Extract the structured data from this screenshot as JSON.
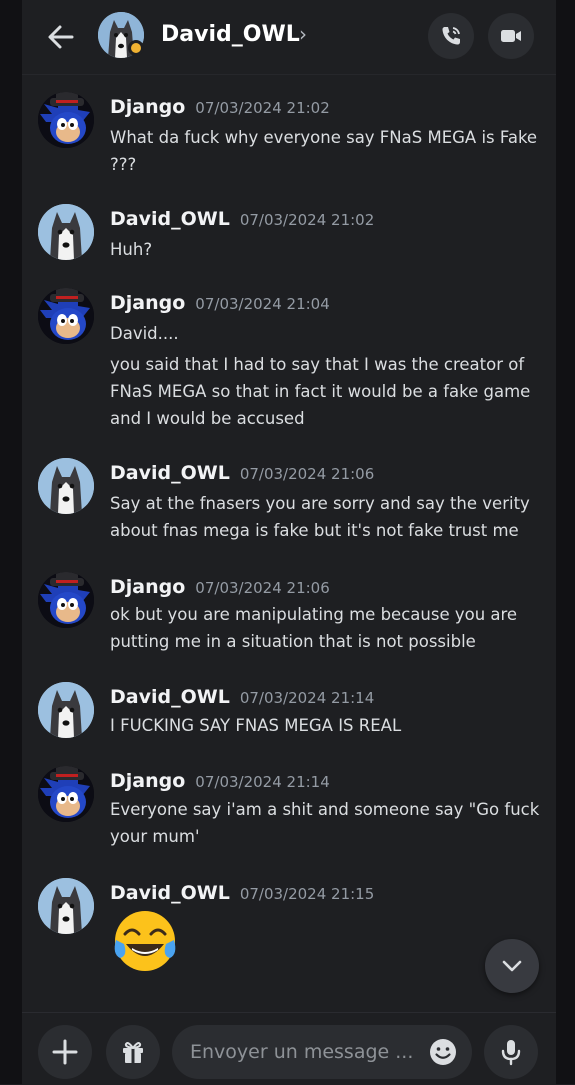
{
  "header": {
    "name": "David_OWL",
    "chevron": "›",
    "icons": [
      "back-arrow-icon",
      "call-icon",
      "video-icon"
    ]
  },
  "messages": [
    {
      "author": "Django",
      "time": "07/03/2024 21:02",
      "text": "What da fuck why everyone say FNaS MEGA is Fake ???",
      "avatar": "sonic-avatar"
    },
    {
      "author": "David_OWL",
      "time": "07/03/2024 21:02",
      "text": "Huh?",
      "avatar": "husky-avatar"
    },
    {
      "author": "Django",
      "time": "07/03/2024 21:04",
      "text": "David....",
      "text2": "you said that I had to say that I was the creator of FNaS MEGA so that in fact it would be a fake game and I would be accused",
      "avatar": "sonic-avatar"
    },
    {
      "author": "David_OWL",
      "time": "07/03/2024 21:06",
      "text": "Say at the fnasers you are sorry and say the verity about fnas mega is fake but it's not fake trust me",
      "avatar": "husky-avatar"
    },
    {
      "author": "Django",
      "time": "07/03/2024 21:06",
      "text": "ok but you are manipulating me because you are putting me in a situation that is not possible",
      "avatar": "sonic-avatar"
    },
    {
      "author": "David_OWL",
      "time": "07/03/2024 21:14",
      "text": "I FUCKING SAY FNAS MEGA IS REAL",
      "avatar": "husky-avatar"
    },
    {
      "author": "Django",
      "time": "07/03/2024 21:14",
      "text": "Everyone say i'am a shit and someone say \"Go fuck your mum'",
      "avatar": "sonic-avatar"
    },
    {
      "author": "David_OWL",
      "time": "07/03/2024 21:15",
      "emoji": "face-with-tears-of-joy",
      "avatar": "husky-avatar"
    }
  ],
  "composer": {
    "placeholder": "Envoyer un message ...",
    "icons": [
      "plus-icon",
      "gift-icon",
      "emoji-icon",
      "microphone-icon"
    ]
  },
  "colors": {
    "background": "#1e1f22",
    "status": "#f0b232",
    "timestamp": "#949ba4"
  }
}
